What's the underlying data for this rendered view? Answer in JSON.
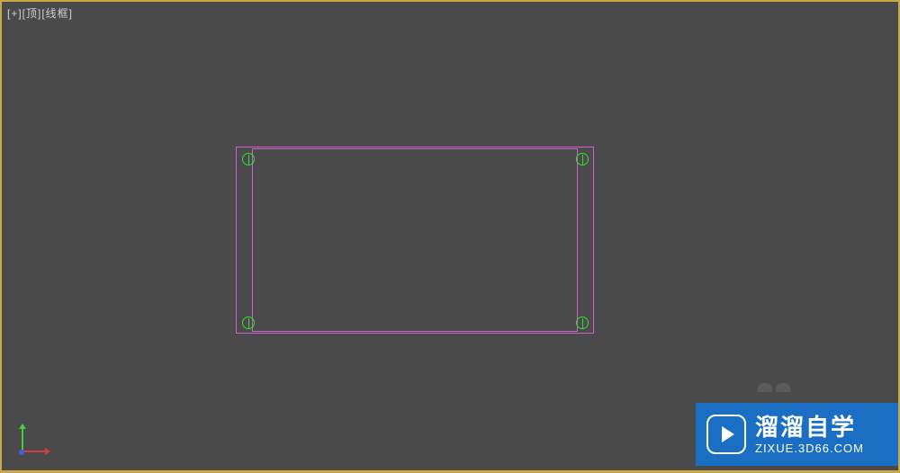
{
  "viewport": {
    "label": "[+][顶][线框]"
  },
  "watermark": {
    "title": "溜溜自学",
    "url": "ZIXUE.3D66.COM"
  },
  "colors": {
    "viewport_border": "#c9a74a",
    "shape": "#d060d0",
    "vertex": "#30e030",
    "axis_x": "#d04040",
    "axis_y": "#40d040",
    "axis_z": "#4060e0",
    "watermark_bg": "#1a6fc4"
  }
}
